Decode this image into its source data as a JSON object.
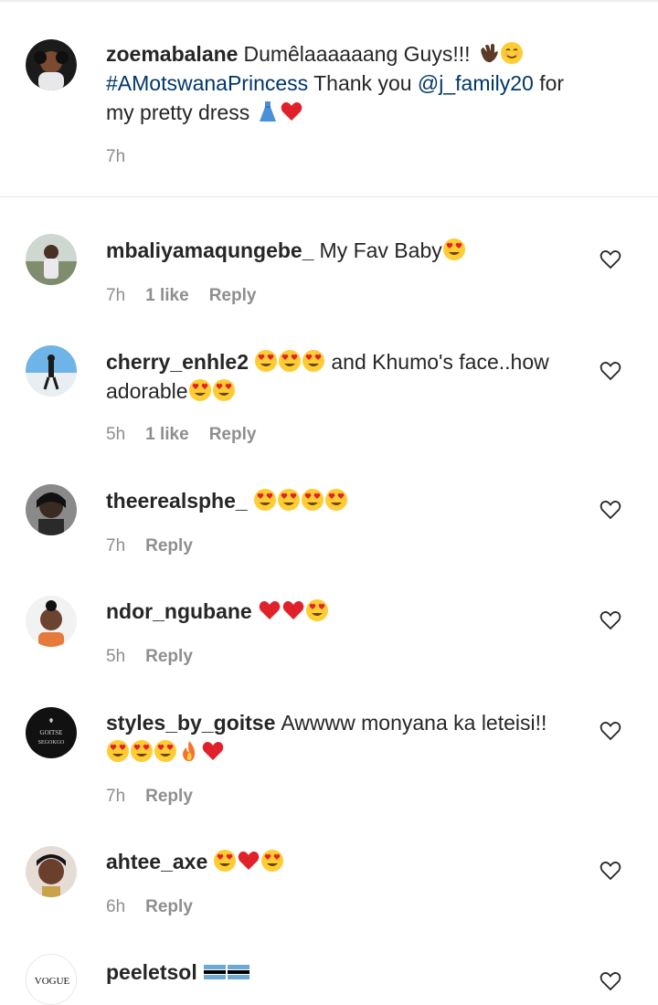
{
  "caption": {
    "username": "zoemabalane",
    "text_line1": "Dumêlaaaaaang Guys!!!",
    "hashtag": "#AMotswanaPrincess",
    "mid_text": " Thank you ",
    "mention": "@j_family20",
    "after_mention": " for",
    "text_line3": "my pretty dress",
    "time": "7h",
    "emojis_line1": [
      "waving-hand-dark-icon",
      "smiling-face-icon"
    ],
    "emojis_line3": [
      "dress-icon",
      "red-heart-icon"
    ]
  },
  "comments": [
    {
      "username": "mbaliyamaqungebe_",
      "text": "My Fav Baby",
      "time": "7h",
      "likes": "1 like",
      "reply": "Reply",
      "emojis": [
        "heart-eyes-icon"
      ]
    },
    {
      "username": "cherry_enhle2",
      "text": "and Khumo's face..how",
      "text2": "adorable",
      "time": "5h",
      "likes": "1 like",
      "reply": "Reply",
      "emojis": [
        "heart-eyes-icon",
        "heart-eyes-icon",
        "heart-eyes-icon"
      ],
      "emojis2": [
        "heart-eyes-icon",
        "heart-eyes-icon"
      ]
    },
    {
      "username": "theerealsphe_",
      "text": "",
      "time": "7h",
      "reply": "Reply",
      "emojis": [
        "heart-eyes-icon",
        "heart-eyes-icon",
        "heart-eyes-icon",
        "heart-eyes-icon"
      ]
    },
    {
      "username": "ndor_ngubane",
      "text": "",
      "time": "5h",
      "reply": "Reply",
      "emojis": [
        "red-heart-icon",
        "red-heart-icon",
        "heart-eyes-icon"
      ]
    },
    {
      "username": "styles_by_goitse",
      "text": "Awwww monyana ka leteisi!!",
      "time": "7h",
      "reply": "Reply",
      "emojis2": [
        "heart-eyes-icon",
        "heart-eyes-icon",
        "heart-eyes-icon",
        "fire-icon",
        "red-heart-icon"
      ],
      "avatar_text1": "GOITSE",
      "avatar_text2": "SEGOKGO"
    },
    {
      "username": "ahtee_axe",
      "text": "",
      "time": "6h",
      "reply": "Reply",
      "emojis": [
        "heart-eyes-icon",
        "red-heart-icon",
        "heart-eyes-icon"
      ]
    },
    {
      "username": "peeletsol",
      "text": "",
      "emojis": [
        "botswana-flag-icon",
        "botswana-flag-icon"
      ],
      "avatar_text1": "VOGUE"
    }
  ],
  "colors": {
    "text": "#262626",
    "secondary": "#8e8e8e",
    "link": "#00376b",
    "divider": "#e3e3e3"
  }
}
